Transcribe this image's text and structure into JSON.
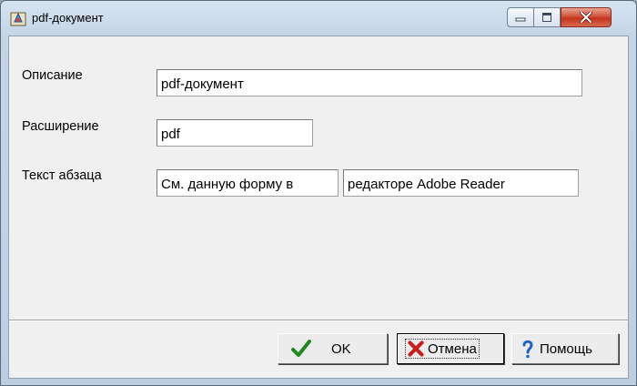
{
  "window": {
    "title": "pdf-документ"
  },
  "form": {
    "description_label": "Описание",
    "description_value": "pdf-документ",
    "extension_label": "Расширение",
    "extension_value": "pdf",
    "paragraph_label": "Текст абзаца",
    "paragraph_value_part1": "См. данную форму в",
    "paragraph_value_part2": "редакторе Adobe Reader"
  },
  "buttons": {
    "ok_label": "OK",
    "cancel_label": "Отмена",
    "help_label": "Помощь"
  },
  "colors": {
    "ok_check": "#1f8a1f",
    "cancel_x": "#c81e1e",
    "help_question": "#1e64c8"
  }
}
